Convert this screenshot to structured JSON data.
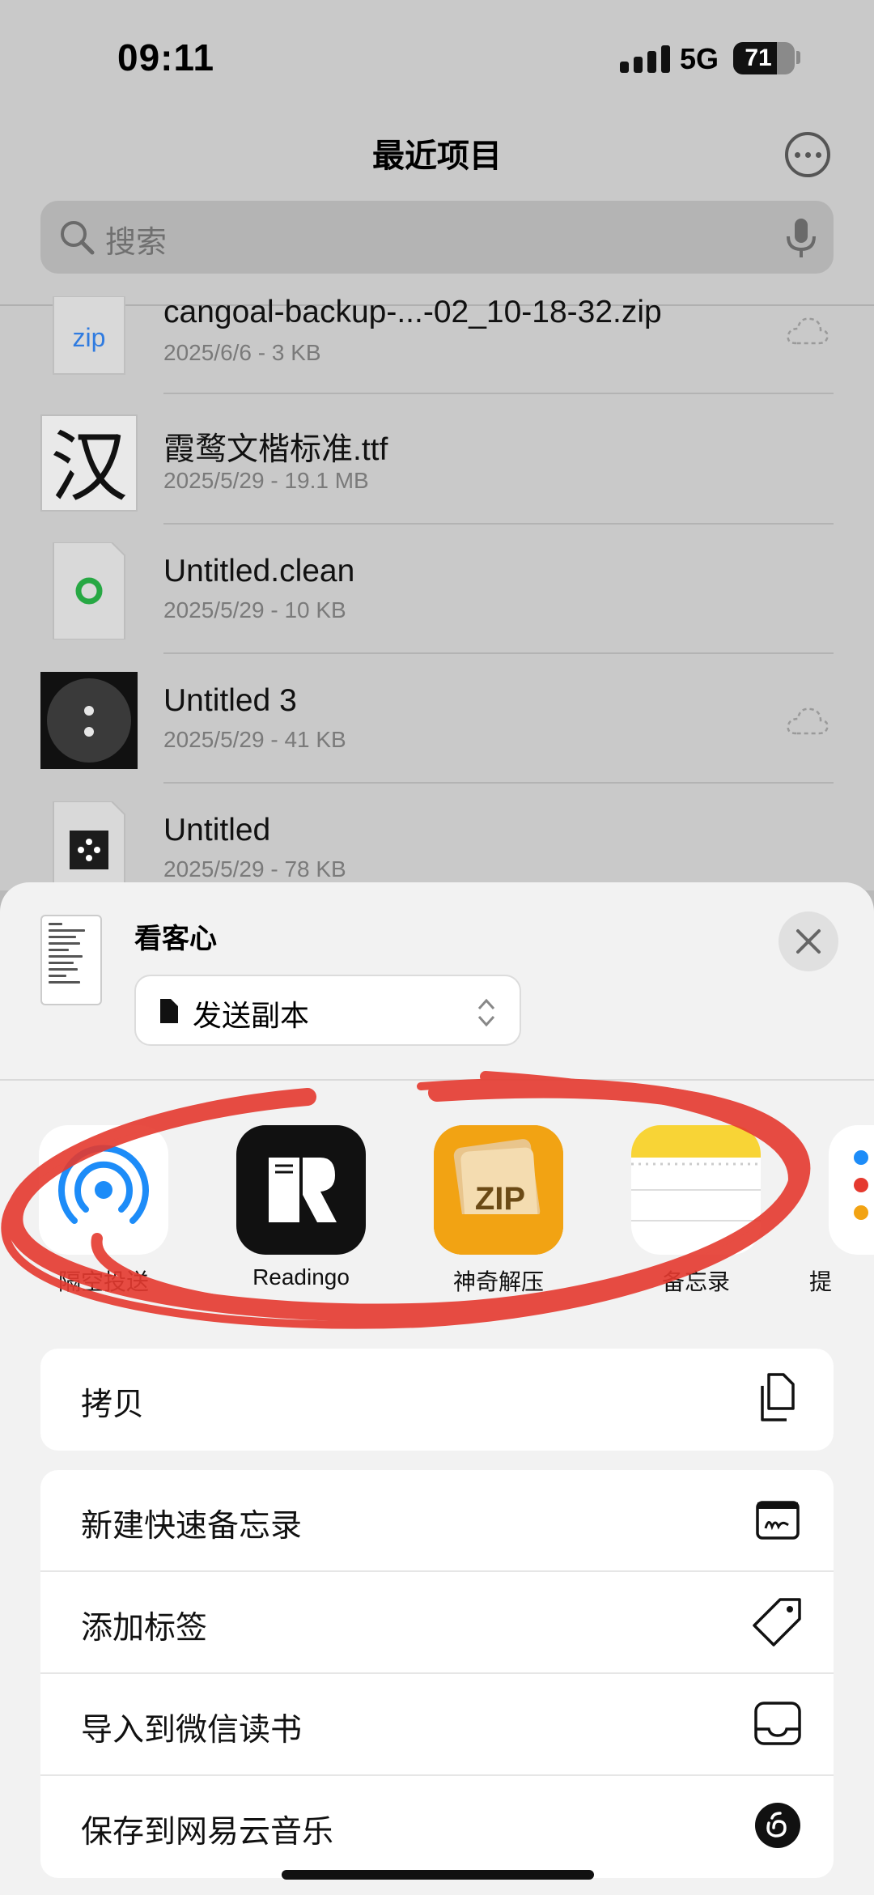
{
  "status_bar": {
    "time": "09:11",
    "network": "5G",
    "battery": "71",
    "battery_level": 0.71
  },
  "header": {
    "title": "最近项目",
    "more_icon": "ellipsis-circle-icon"
  },
  "search": {
    "placeholder": "搜索"
  },
  "files": [
    {
      "name": "cangoal-backup-...-02_10-18-32.zip",
      "meta": "2025/6/6 - 3 KB",
      "icon": "zip",
      "cloud": true
    },
    {
      "name": "霞鹜文楷标准.ttf",
      "meta": "2025/5/29 - 19.1 MB",
      "icon": "汉",
      "cloud": false
    },
    {
      "name": "Untitled.clean",
      "meta": "2025/5/29 - 10 KB",
      "icon": "clean-file-icon",
      "cloud": false
    },
    {
      "name": "Untitled 3",
      "meta": "2025/5/29 - 41 KB",
      "icon": "dark-dial-icon",
      "cloud": true
    },
    {
      "name": "Untitled",
      "meta": "2025/5/29 - 78 KB",
      "icon": "dots-file-icon",
      "cloud": false
    }
  ],
  "share_sheet": {
    "title": "看客心",
    "send_option": "发送副本",
    "apps": [
      {
        "label": "隔空投送",
        "icon": "airdrop-icon"
      },
      {
        "label": "Readingo",
        "icon": "readingo-icon"
      },
      {
        "label": "神奇解压",
        "icon": "zip-app-icon",
        "icon_text": "ZIP"
      },
      {
        "label": "备忘录",
        "icon": "notes-icon"
      },
      {
        "label": "提",
        "icon": "reminders-icon"
      }
    ],
    "copy_action": {
      "label": "拷贝",
      "icon": "copy-icon"
    },
    "actions": [
      {
        "label": "新建快速备忘录",
        "icon": "quick-note-icon"
      },
      {
        "label": "添加标签",
        "icon": "tag-icon"
      },
      {
        "label": "导入到微信读书",
        "icon": "inbox-tray-icon"
      },
      {
        "label": "保存到网易云音乐",
        "icon": "netease-music-icon"
      }
    ]
  },
  "colors": {
    "accent_red": "#e53a2f",
    "airdrop_blue": "#1d8cf8",
    "zip_orange": "#f2a313",
    "notes_yellow": "#f8d436"
  }
}
